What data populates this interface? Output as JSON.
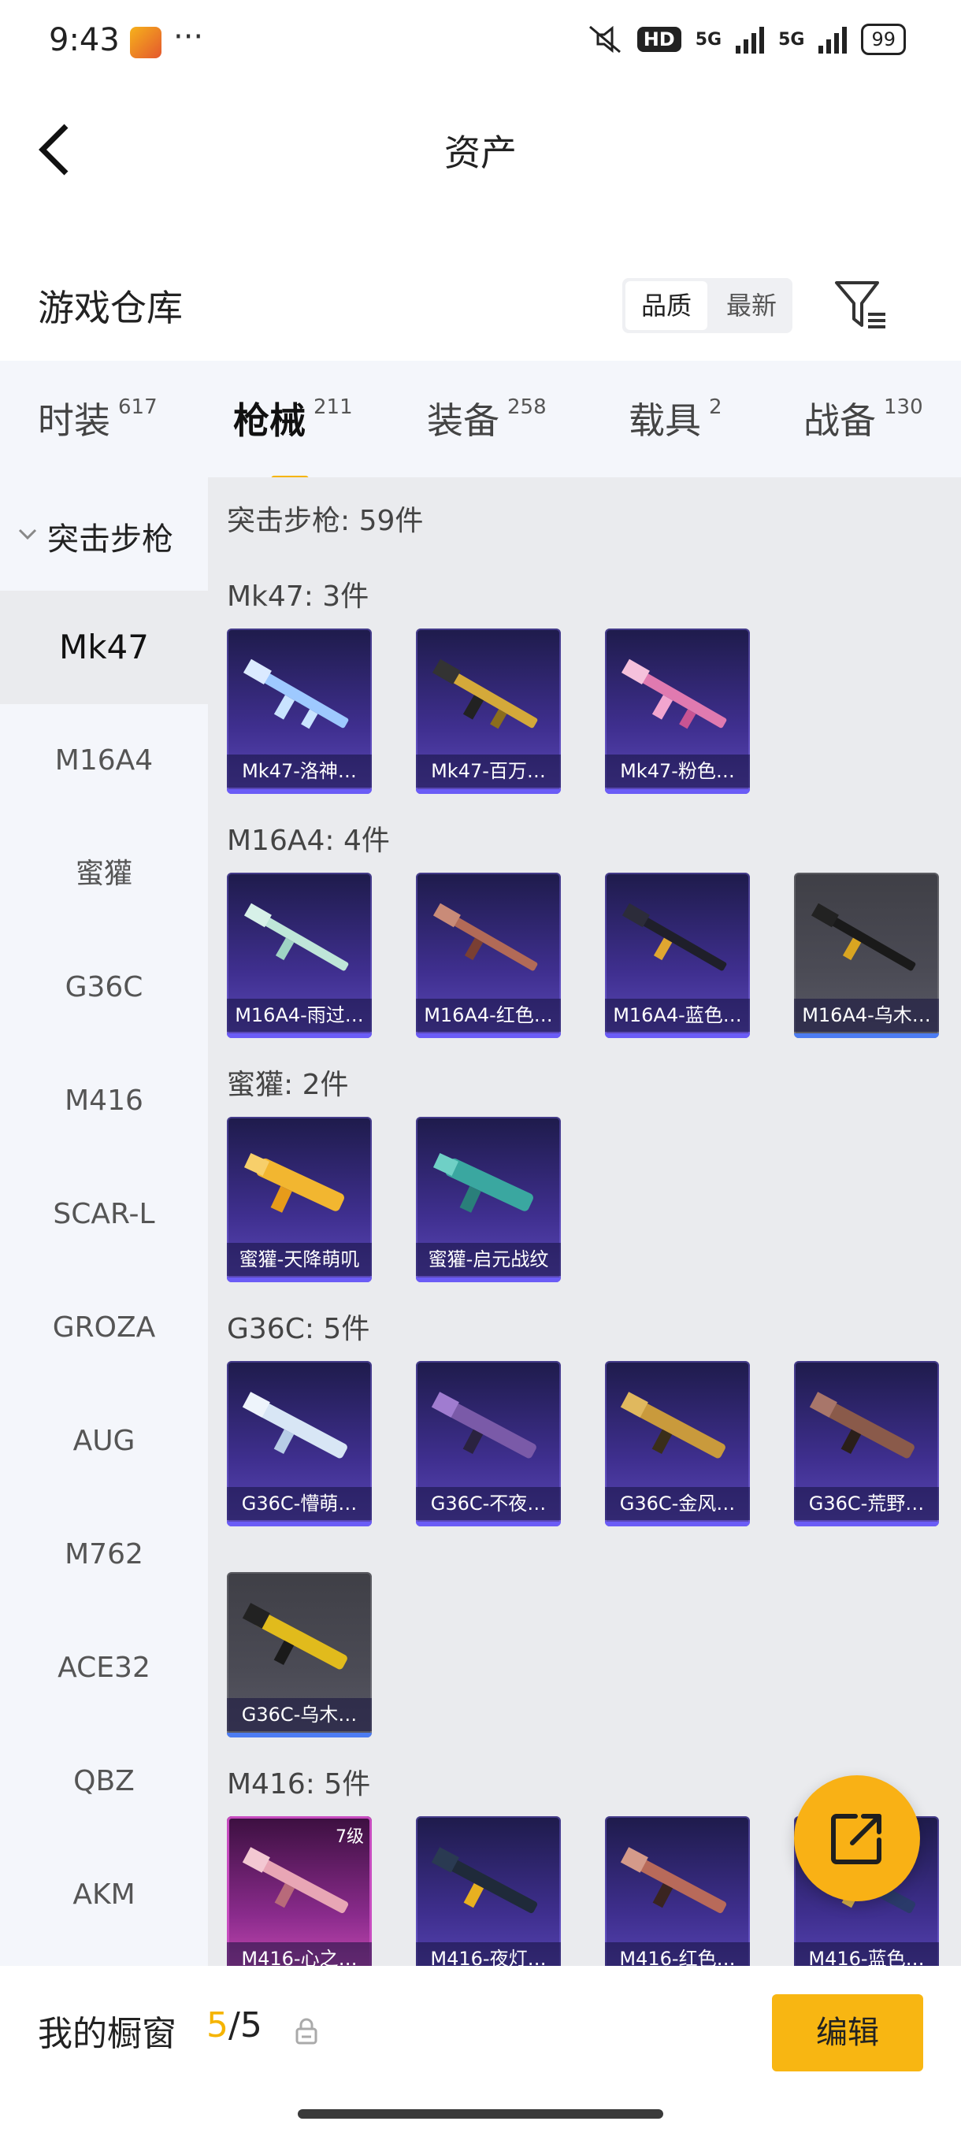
{
  "status_bar": {
    "time": "9:43",
    "dots": "···",
    "hd_badge": "HD",
    "net1": "5G",
    "net2": "5G",
    "battery": "99"
  },
  "header": {
    "title": "资产",
    "back_icon": "chevron-left-icon"
  },
  "repo": {
    "title": "游戏仓库",
    "sort_options": [
      "品质",
      "最新"
    ],
    "filter_icon": "filter-icon"
  },
  "categories": [
    {
      "label": "时装",
      "count": "617"
    },
    {
      "label": "枪械",
      "count": "211"
    },
    {
      "label": "装备",
      "count": "258"
    },
    {
      "label": "载具",
      "count": "2"
    },
    {
      "label": "战备",
      "count": "130"
    }
  ],
  "sidebar": {
    "group": "突击步枪",
    "items": [
      "Mk47",
      "M16A4",
      "蜜獾",
      "G36C",
      "M416",
      "SCAR-L",
      "GROZA",
      "AUG",
      "M762",
      "ACE32",
      "QBZ",
      "AKM"
    ]
  },
  "content": {
    "summary": "突击步枪: 59件",
    "sections": [
      {
        "title": "Mk47: 3件",
        "items": [
          "Mk47-洛神…",
          "Mk47-百万…",
          "Mk47-粉色…"
        ]
      },
      {
        "title": "M16A4: 4件",
        "items": [
          "M16A4-雨过…",
          "M16A4-红色…",
          "M16A4-蓝色…",
          "M16A4-乌木…"
        ]
      },
      {
        "title": "蜜獾: 2件",
        "items": [
          "蜜獾-天降萌叽",
          "蜜獾-启元战纹"
        ]
      },
      {
        "title": "G36C: 5件",
        "items": [
          "G36C-懵萌…",
          "G36C-不夜…",
          "G36C-金风…",
          "G36C-荒野…",
          "G36C-乌木…"
        ]
      },
      {
        "title": "M416: 5件",
        "items": [
          "M416-心之…",
          "M416-夜灯…",
          "M416-红色…",
          "M416-蓝色…"
        ],
        "first_level": "7级"
      }
    ]
  },
  "bottom_bar": {
    "label": "我的橱窗",
    "count_used": "5",
    "count_sep": "/",
    "count_total": "5",
    "edit_label": "编辑"
  },
  "colors": {
    "accent": "#f5b400",
    "card_purple": "#3f2f8f",
    "card_grey": "#4b4b55"
  }
}
